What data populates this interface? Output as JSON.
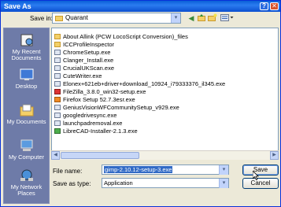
{
  "window": {
    "title": "Save As",
    "help_glyph": "?",
    "close_glyph": "✕"
  },
  "toolbar": {
    "look_in_label": "Save in:",
    "look_in_value": "Quarant",
    "dropdown_arrow": "▾",
    "back_glyph": "◀",
    "up_glyph": "↑",
    "new_folder_glyph": "✦",
    "views_glyph": "☷▾"
  },
  "places": [
    {
      "label": "My Recent Documents",
      "icon": "recent-documents-icon"
    },
    {
      "label": "Desktop",
      "icon": "desktop-icon"
    },
    {
      "label": "My Documents",
      "icon": "my-documents-icon"
    },
    {
      "label": "My Computer",
      "icon": "my-computer-icon"
    },
    {
      "label": "My Network Places",
      "icon": "network-places-icon"
    }
  ],
  "files": [
    {
      "name": "About Allink (PCW LocoScript Conversion)_files",
      "type": "folder"
    },
    {
      "name": "ICCProfileInspector",
      "type": "folder"
    },
    {
      "name": "ChromeSetup.exe",
      "type": "exe"
    },
    {
      "name": "Clanger_Install.exe",
      "type": "exe"
    },
    {
      "name": "CrucialUKScan.exe",
      "type": "exe"
    },
    {
      "name": "CuteWriter.exe",
      "type": "exe"
    },
    {
      "name": "Elonex+621eb+driver+download_10924_i79333376_il345.exe",
      "type": "exe"
    },
    {
      "name": "FileZilla_3.8.0_win32-setup.exe",
      "type": "exe-red"
    },
    {
      "name": "Firefox Setup 52.7.3esr.exe",
      "type": "exe-orange"
    },
    {
      "name": "GeniusVisionWFCommunitySetup_v929.exe",
      "type": "exe"
    },
    {
      "name": "googledrivesync.exe",
      "type": "exe"
    },
    {
      "name": "launchpadremoval.exe",
      "type": "exe"
    },
    {
      "name": "LibreCAD-Installer-2.1.3.exe",
      "type": "exe-green"
    }
  ],
  "scrollbar": {
    "left_glyph": "◀",
    "right_glyph": "▶"
  },
  "form": {
    "file_name_label": "File name:",
    "file_name_value": "gimp-2.10.12-setup-3.exe",
    "save_as_type_label": "Save as type:",
    "save_as_type_value": "Application"
  },
  "buttons": {
    "save": "Save",
    "cancel": "Cancel"
  }
}
